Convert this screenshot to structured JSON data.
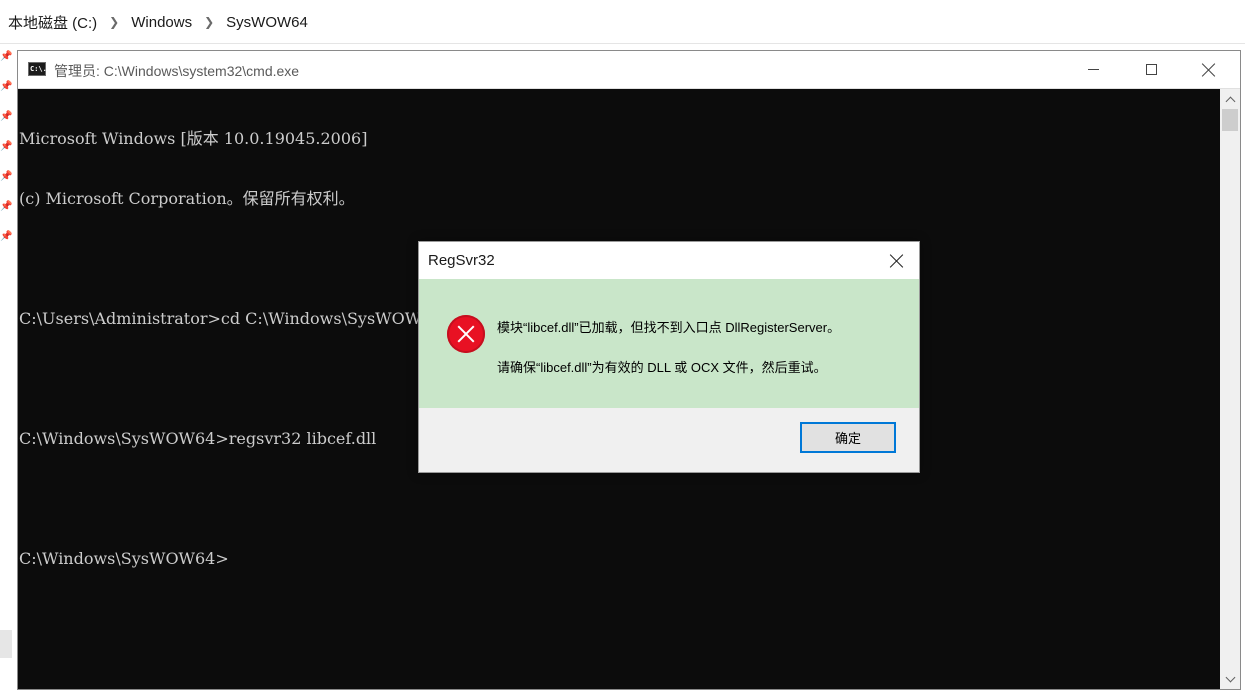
{
  "explorer": {
    "breadcrumb": [
      "本地磁盘 (C:)",
      "Windows",
      "SysWOW64"
    ]
  },
  "cmd": {
    "title": "管理员: C:\\Windows\\system32\\cmd.exe",
    "icon_label": "C:\\.",
    "lines": [
      "Microsoft Windows [版本 10.0.19045.2006]",
      "(c) Microsoft Corporation。保留所有权利。",
      "",
      "C:\\Users\\Administrator>cd C:\\Windows\\SysWOW64",
      "",
      "C:\\Windows\\SysWOW64>regsvr32 libcef.dll",
      "",
      "C:\\Windows\\SysWOW64>"
    ]
  },
  "dialog": {
    "title": "RegSvr32",
    "message_line1": "模块“libcef.dll”已加载，但找不到入口点 DllRegisterServer。",
    "message_line2": "请确保“libcef.dll”为有效的 DLL 或 OCX 文件，然后重试。",
    "ok_label": "确定",
    "body_color": "#c9e6c9",
    "error_icon": "error-x-icon"
  },
  "colors": {
    "console_bg": "#0c0c0c",
    "console_fg": "#cccccc",
    "accent": "#0078d7",
    "error": "#e81123"
  }
}
